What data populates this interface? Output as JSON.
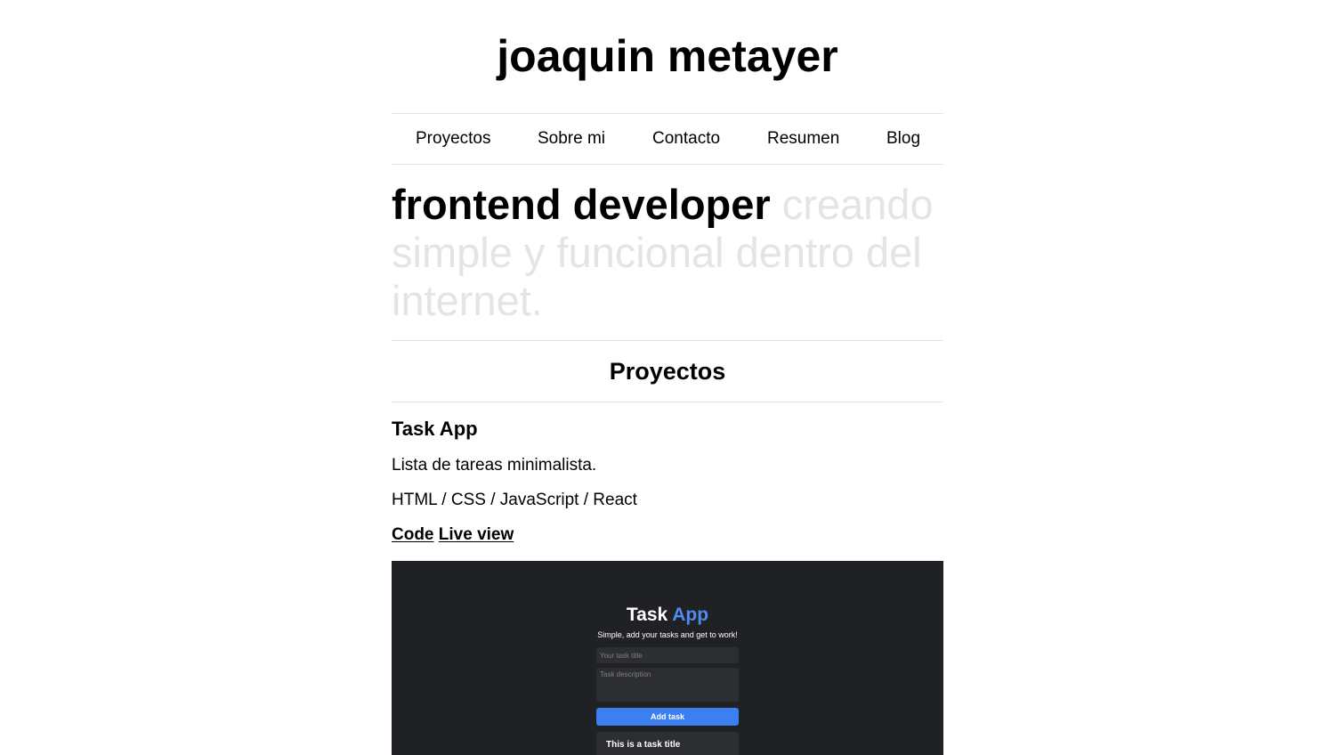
{
  "site": {
    "title": "joaquin metayer"
  },
  "nav": {
    "items": [
      {
        "label": "Proyectos"
      },
      {
        "label": "Sobre mi"
      },
      {
        "label": "Contacto"
      },
      {
        "label": "Resumen"
      },
      {
        "label": "Blog"
      }
    ]
  },
  "hero": {
    "strong": "frontend developer",
    "rest": " creando simple y funcional dentro del internet."
  },
  "projects": {
    "heading": "Proyectos",
    "items": [
      {
        "title": "Task App",
        "description": "Lista de tareas minimalista.",
        "stack": "HTML / CSS / JavaScript / React",
        "code_label": "Code",
        "live_label": "Live view",
        "preview": {
          "title_main": "Task",
          "title_accent": "App",
          "subtitle": "Simple, add your tasks and get to work!",
          "title_placeholder": "Your task title",
          "description_placeholder": "Task description",
          "button_label": "Add task",
          "task_title": "This is a task title"
        }
      }
    ]
  },
  "colors": {
    "background": "#ffffff",
    "text": "#000000",
    "muted_text": "#e4e4e4",
    "divider": "#e3e3e3",
    "preview_background": "#202124",
    "accent": "#4f8bf0",
    "button": "#3c7ff0"
  }
}
